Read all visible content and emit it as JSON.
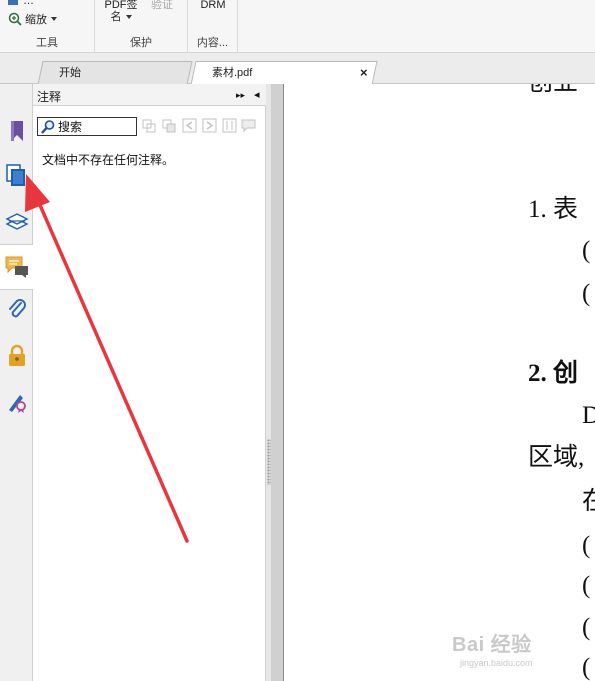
{
  "ribbon": {
    "tools_group": {
      "top_truncated_label": "…",
      "zoom_label": "缩放",
      "group_label": "工具"
    },
    "protect_group": {
      "pdf_sign_label_line1": "PDF签",
      "pdf_sign_label_line2": "名",
      "verify_label": "验证",
      "group_label": "保护"
    },
    "content_group": {
      "drm_label": "DRM",
      "group_label": "内容..."
    }
  },
  "tabs": [
    {
      "label": "开始",
      "active": false
    },
    {
      "label": "素材.pdf",
      "active": true,
      "close": "×"
    }
  ],
  "rail": {
    "icons": [
      "bookmark-icon",
      "pages-icon",
      "layers-icon",
      "comments-icon",
      "attachment-icon",
      "lock-icon",
      "signature-icon"
    ],
    "active": "comments-icon"
  },
  "panel": {
    "title": "注释",
    "expand_glyph": "▸▸",
    "collapse_glyph": "◂",
    "search_placeholder": "搜索",
    "empty_message": "文档中不存在任何注释。"
  },
  "document": {
    "lines": [
      {
        "text": "创业",
        "bold": false
      },
      {
        "text": "1.   表",
        "bold": false
      },
      {
        "text": "(",
        "bold": false
      },
      {
        "text": "(",
        "bold": false
      },
      {
        "text": "2.  创",
        "bold": true
      },
      {
        "text": "D",
        "bold": false
      },
      {
        "text": "区域,",
        "bold": false
      },
      {
        "text": "在",
        "bold": false
      },
      {
        "text": "(",
        "bold": false
      },
      {
        "text": "(",
        "bold": false
      },
      {
        "text": "(",
        "bold": false
      },
      {
        "text": "(",
        "bold": false
      }
    ]
  },
  "watermark": {
    "brand": "Bai 经验",
    "url": "jingyan.baidu.com"
  },
  "colors": {
    "arrow": "#e8363e",
    "bookmark_purple": "#6b4fa3",
    "pages_blue": "#1f5fa8",
    "comment_yellow": "#f0b84a",
    "lock_gold": "#e2a226"
  }
}
